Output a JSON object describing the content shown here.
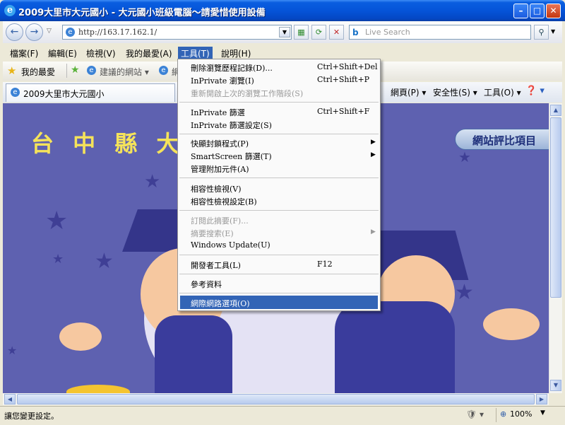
{
  "window": {
    "title": "2009大里市大元國小 - 大元國小班級電腦～請愛惜使用設備"
  },
  "address": {
    "url": "http://163.17.162.1/",
    "search_placeholder": "Live Search"
  },
  "menubar": [
    "檔案(F)",
    "編輯(E)",
    "檢視(V)",
    "我的最愛(A)",
    "工具(T)",
    "說明(H)"
  ],
  "favbar": {
    "favorites": "我的最愛",
    "suggested": "建議的網站 ▾",
    "web": "網"
  },
  "tab": {
    "title": "2009大里市大元國小"
  },
  "cmdbar": {
    "page": "網頁(P) ▾",
    "safety": "安全性(S) ▾",
    "tools": "工具(O) ▾",
    "help": "❓ ▾"
  },
  "content": {
    "banner": "台 中 縣 大",
    "badge": "網站評比項目"
  },
  "tools_menu": {
    "items": [
      {
        "label": "刪除瀏覽歷程記錄(D)...",
        "shortcut": "Ctrl+Shift+Del"
      },
      {
        "label": "InPrivate 瀏覽(I)",
        "shortcut": "Ctrl+Shift+P"
      },
      {
        "label": "重新開啟上次的瀏覽工作階段(S)",
        "shortcut": ""
      },
      {
        "label": "InPrivate 篩選",
        "shortcut": "Ctrl+Shift+F"
      },
      {
        "label": "InPrivate 篩選設定(S)",
        "shortcut": ""
      },
      {
        "label": "快顯封鎖程式(P)",
        "shortcut": ""
      },
      {
        "label": "SmartScreen 篩選(T)",
        "shortcut": ""
      },
      {
        "label": "管理附加元件(A)",
        "shortcut": ""
      },
      {
        "label": "相容性檢視(V)",
        "shortcut": ""
      },
      {
        "label": "相容性檢視設定(B)",
        "shortcut": ""
      },
      {
        "label": "訂閱此摘要(F)...",
        "shortcut": ""
      },
      {
        "label": "摘要搜索(E)",
        "shortcut": ""
      },
      {
        "label": "Windows Update(U)",
        "shortcut": ""
      },
      {
        "label": "開發者工具(L)",
        "shortcut": "F12"
      },
      {
        "label": "參考資料",
        "shortcut": ""
      },
      {
        "label": "網際網路選項(O)",
        "shortcut": ""
      }
    ]
  },
  "status": {
    "text": "讓您變更設定。",
    "zoom": "100%"
  },
  "colors": {
    "titlebar": "#0554d8",
    "content_bg": "#5e61b0",
    "highlight": "#3264b6"
  }
}
